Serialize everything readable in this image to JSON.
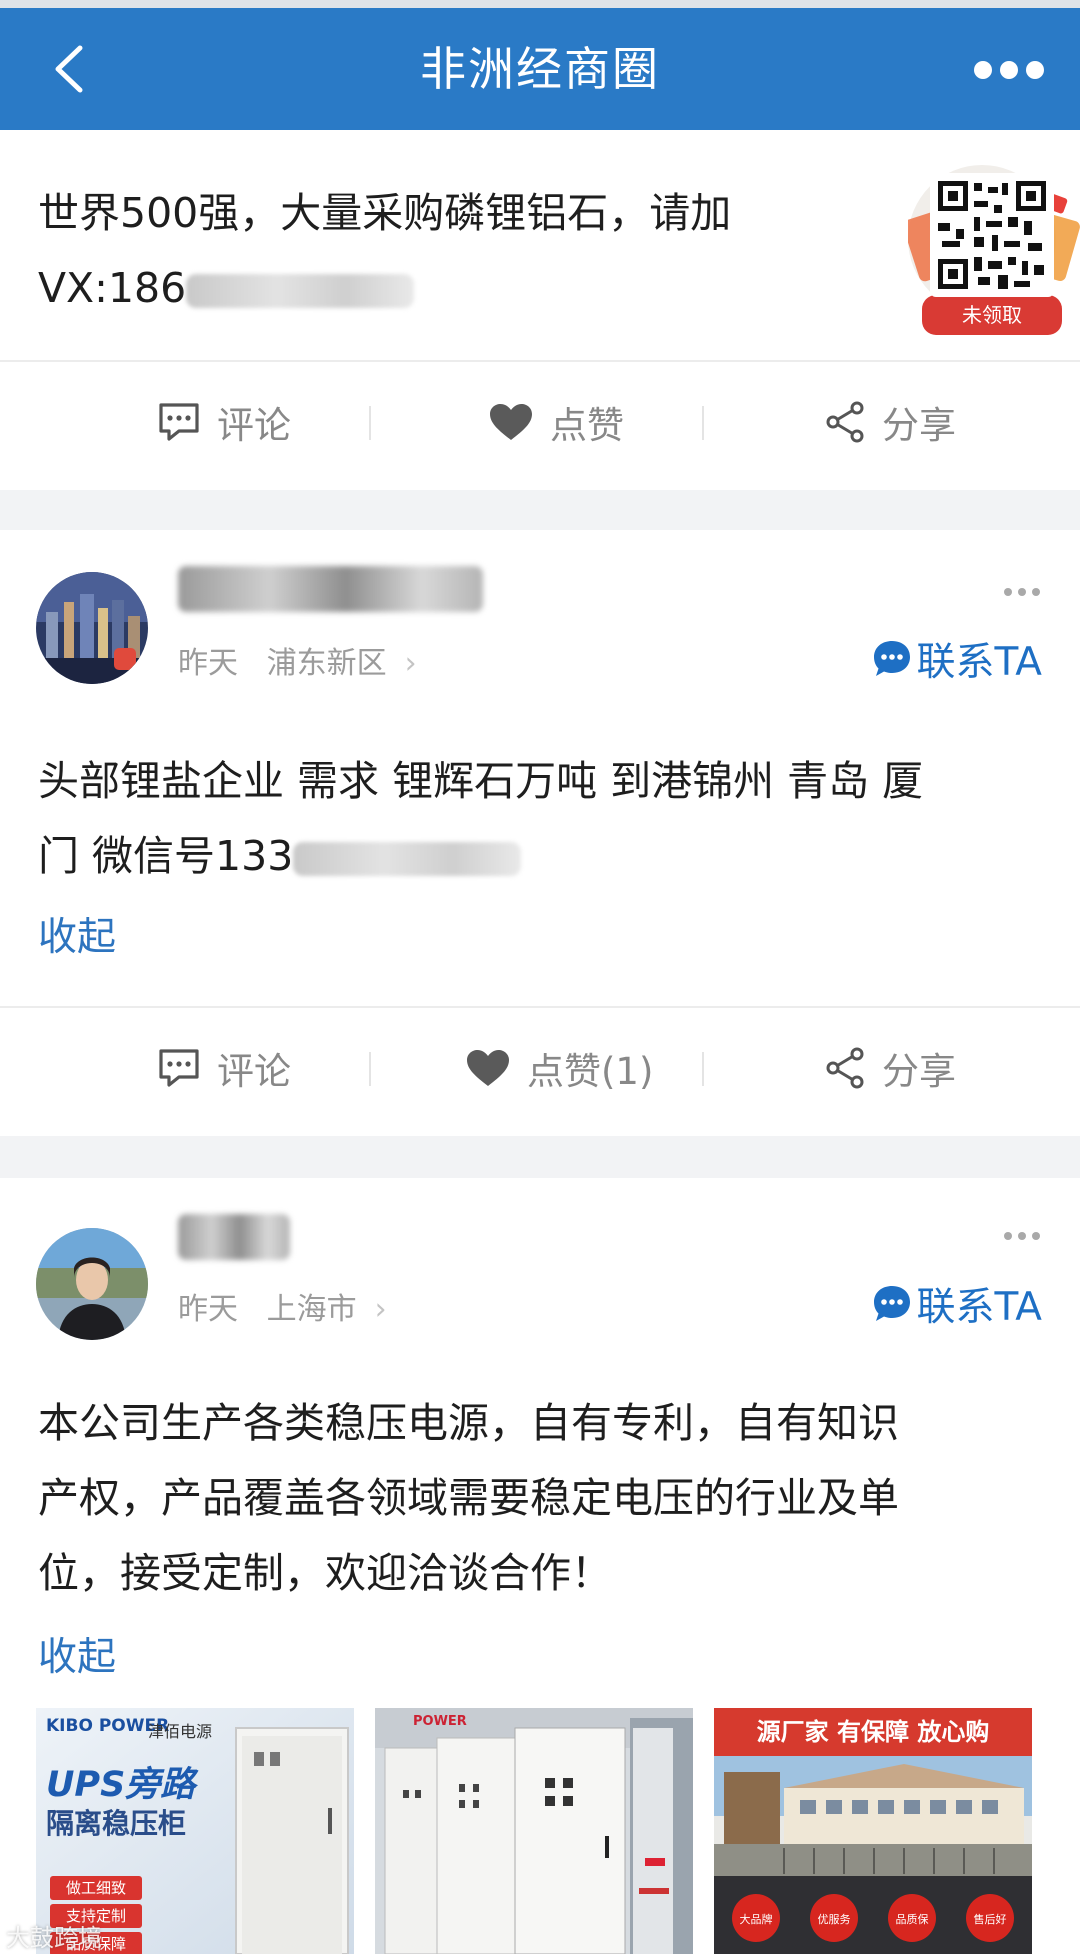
{
  "nav": {
    "title": "非洲经商圈",
    "back_icon": "chevron-left-icon",
    "more_icon": "more-dots-icon"
  },
  "posts": [
    {
      "text_line1": "世界500强，大量采购磷锂铝石，请加",
      "text_line2_visible": "VX:186",
      "qr_badge": "未领取",
      "actions": {
        "comment": "评论",
        "like": "点赞",
        "share": "分享"
      }
    },
    {
      "time": "昨天",
      "location": "浦东新区",
      "contact": "联系TA",
      "text_line1": "头部锂盐企业 需求 锂辉石万吨 到港锦州 青岛 厦",
      "text_line2_visible": "门 微信号133",
      "collapse": "收起",
      "actions": {
        "comment": "评论",
        "like": "点赞(1)",
        "share": "分享"
      }
    },
    {
      "time": "昨天",
      "location": "上海市",
      "contact": "联系TA",
      "text_line1": "本公司生产各类稳压电源，自有专利，自有知识",
      "text_line2": "产权，产品覆盖各领域需要稳定电压的行业及单",
      "text_line3": "位，接受定制，欢迎洽谈合作！",
      "collapse": "收起",
      "images": [
        {
          "brand": "KIBO POWER",
          "brand_cn": "津佰电源",
          "headline1": "UPS旁路",
          "headline2": "隔离稳压柜",
          "tags": [
            "做工细致",
            "支持定制",
            "品质保障"
          ]
        },
        {
          "caption": "POWER"
        },
        {
          "banner": "源厂家 有保障 放心购",
          "badges": [
            "大品牌",
            "优服务",
            "品质保",
            "售后好"
          ]
        }
      ]
    }
  ],
  "watermark": "大鼓跨境",
  "colors": {
    "nav_bg": "#2a7ac6",
    "link_blue": "#1e6fc4",
    "collapse_blue": "#2d74bf",
    "muted_text": "#9b9b9b",
    "section_gap": "#f2f3f5"
  }
}
